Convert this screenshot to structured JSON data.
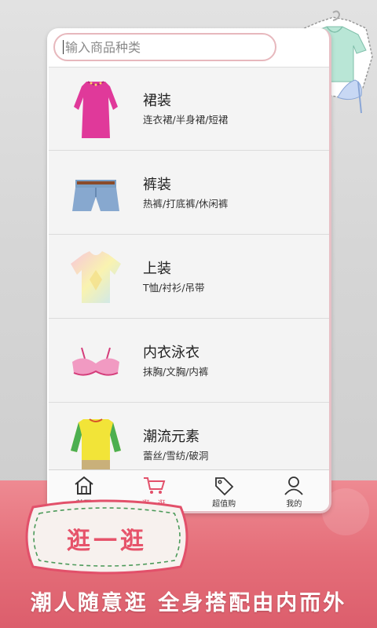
{
  "search": {
    "placeholder": "输入商品种类",
    "icon": "cursor"
  },
  "categories": [
    {
      "title": "裙装",
      "subtitle": "连衣裙/半身裙/短裙",
      "icon": "pink-dress"
    },
    {
      "title": "裤装",
      "subtitle": "热裤/打底裤/休闲裤",
      "icon": "denim-shorts"
    },
    {
      "title": "上装",
      "subtitle": "T恤/衬衫/吊带",
      "icon": "tie-dye-top"
    },
    {
      "title": "内衣泳衣",
      "subtitle": "抹胸/文胸/内裤",
      "icon": "pink-bra"
    },
    {
      "title": "潮流元素",
      "subtitle": "蕾丝/雪纺/破洞",
      "icon": "colorblock-dress"
    }
  ],
  "tabs": [
    {
      "label": "首页",
      "icon": "home-icon",
      "active": false
    },
    {
      "label": "逛一逛",
      "icon": "cart-icon",
      "active": true
    },
    {
      "label": "超值购",
      "icon": "price-tag-icon",
      "active": false
    },
    {
      "label": "我的",
      "icon": "user-icon",
      "active": false
    }
  ],
  "promo": {
    "badge_text": "逛一逛",
    "slogan": "潮人随意逛 全身搭配由内而外"
  },
  "colors": {
    "accent": "#e2506a",
    "pink_band": "#e56f7a",
    "card_border": "#e7c0c6",
    "list_bg": "#f4f4f4"
  }
}
